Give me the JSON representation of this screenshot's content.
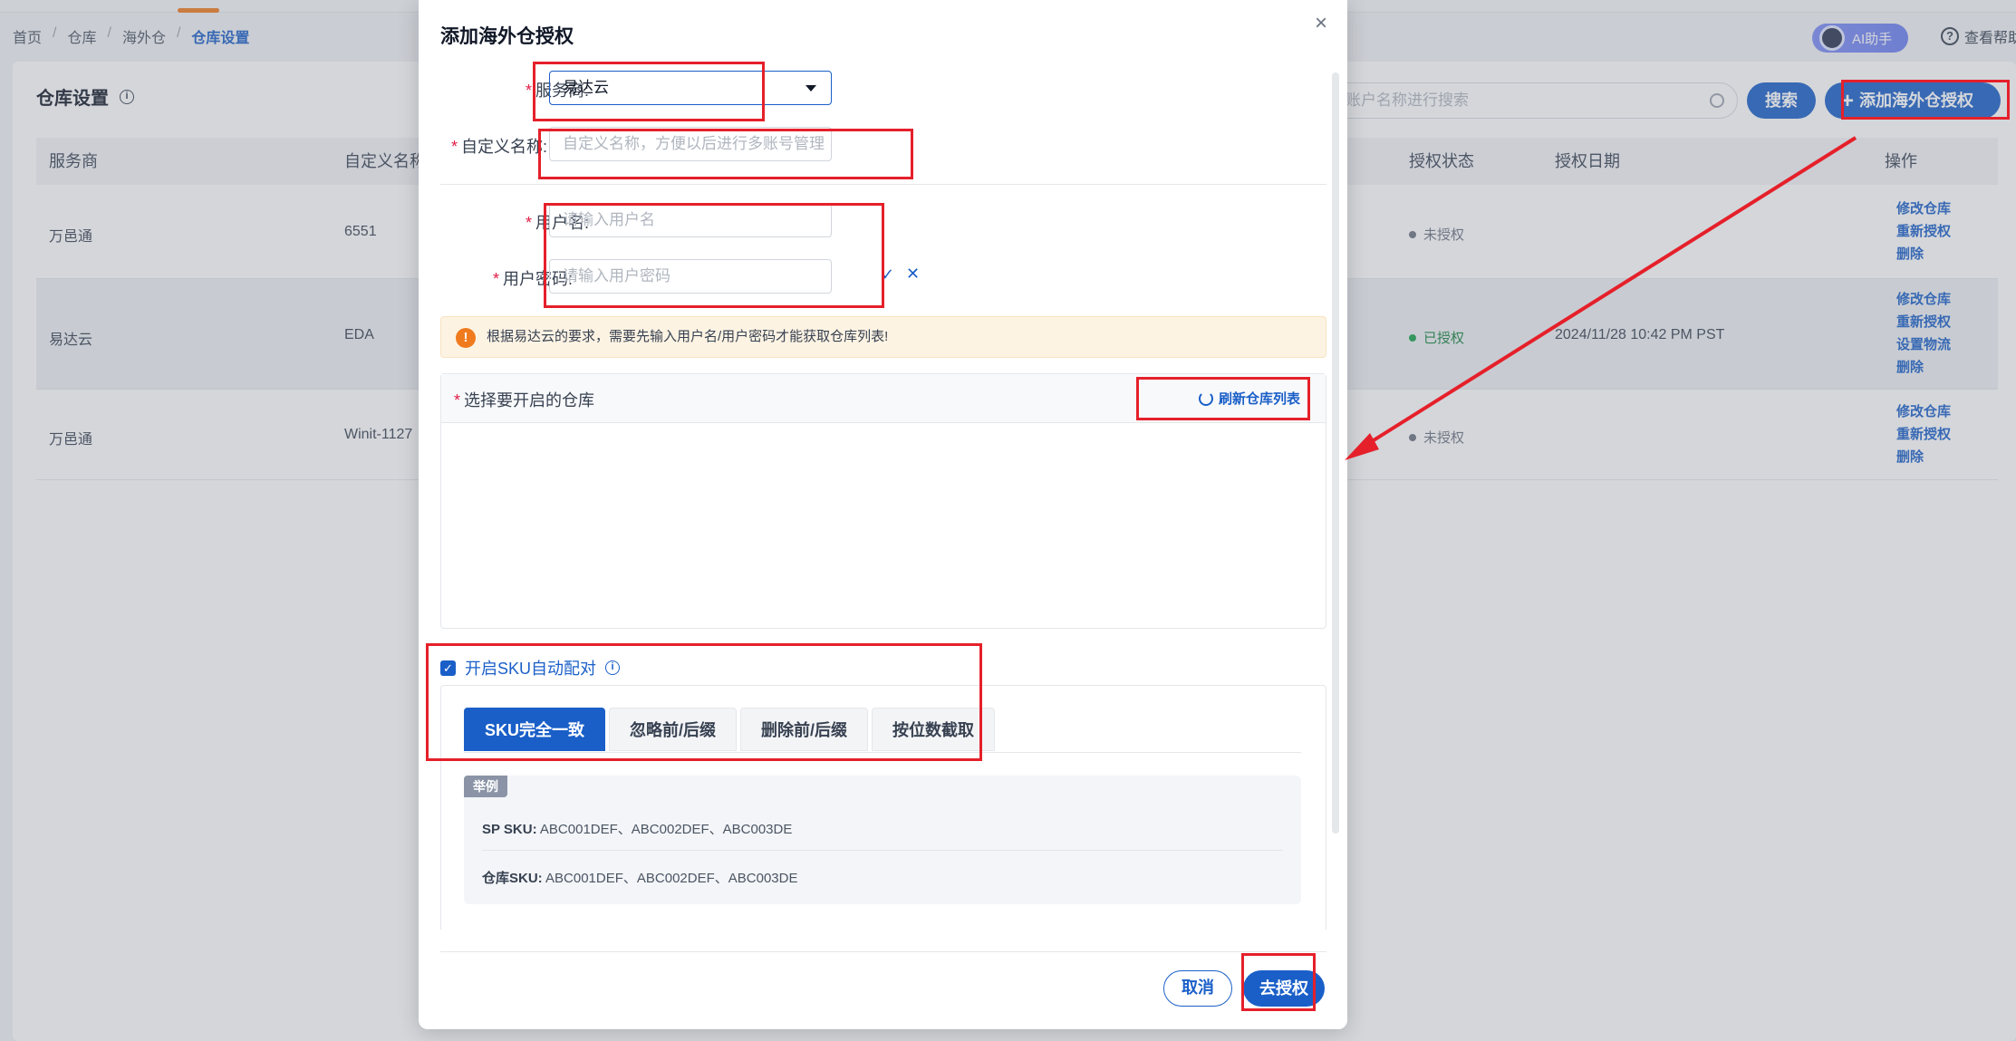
{
  "breadcrumb": [
    "首页",
    "仓库",
    "海外仓",
    "仓库设置"
  ],
  "header": {
    "ai_label": "AI助手",
    "help_label": "查看帮助"
  },
  "page": {
    "title": "仓库设置"
  },
  "toolbar": {
    "search_placeholder": "账户名称进行搜索",
    "search_label": "搜索",
    "add_label": "添加海外仓授权"
  },
  "table": {
    "columns": [
      "服务商",
      "自定义名称",
      "授权状态",
      "授权日期",
      "操作"
    ],
    "rows": [
      {
        "provider": "万邑通",
        "name": "6551",
        "status": "未授权",
        "date": "",
        "ops": [
          "修改仓库",
          "重新授权",
          "删除"
        ]
      },
      {
        "provider": "易达云",
        "name": "EDA",
        "status": "已授权",
        "date": "2024/11/28 10:42 PM PST",
        "ops": [
          "修改仓库",
          "重新授权",
          "设置物流",
          "删除"
        ]
      },
      {
        "provider": "万邑通",
        "name": "Winit-1127",
        "status": "未授权",
        "date": "",
        "ops": [
          "修改仓库",
          "重新授权",
          "删除"
        ]
      }
    ]
  },
  "modal": {
    "title": "添加海外仓授权",
    "provider_label": "服务商:",
    "provider_value": "易达云",
    "custom_name_label": "自定义名称:",
    "custom_name_placeholder": "自定义名称，方便以后进行多账号管理",
    "username_label": "用户名:",
    "username_placeholder": "请输入用户名",
    "password_label": "用户密码:",
    "password_placeholder": "请输入用户密码",
    "alert_text": "根据易达云的要求，需要先输入用户名/用户密码才能获取仓库列表!",
    "warehouse_label": "选择要开启的仓库",
    "refresh_label": "刷新仓库列表",
    "sku_auto_label": "开启SKU自动配对",
    "sku_tabs": [
      "SKU完全一致",
      "忽略前/后缀",
      "删除前/后缀",
      "按位数截取"
    ],
    "example_tag": "举例",
    "example_sp_label": "SP SKU:",
    "example_sp_value": "ABC001DEF、ABC002DEF、ABC003DE",
    "example_wh_label": "仓库SKU:",
    "example_wh_value": "ABC001DEF、ABC002DEF、ABC003DE",
    "cancel_label": "取消",
    "submit_label": "去授权"
  },
  "colors": {
    "primary": "#1a5fc8",
    "annotation": "#e5202a",
    "warning": "#f07b1e"
  }
}
